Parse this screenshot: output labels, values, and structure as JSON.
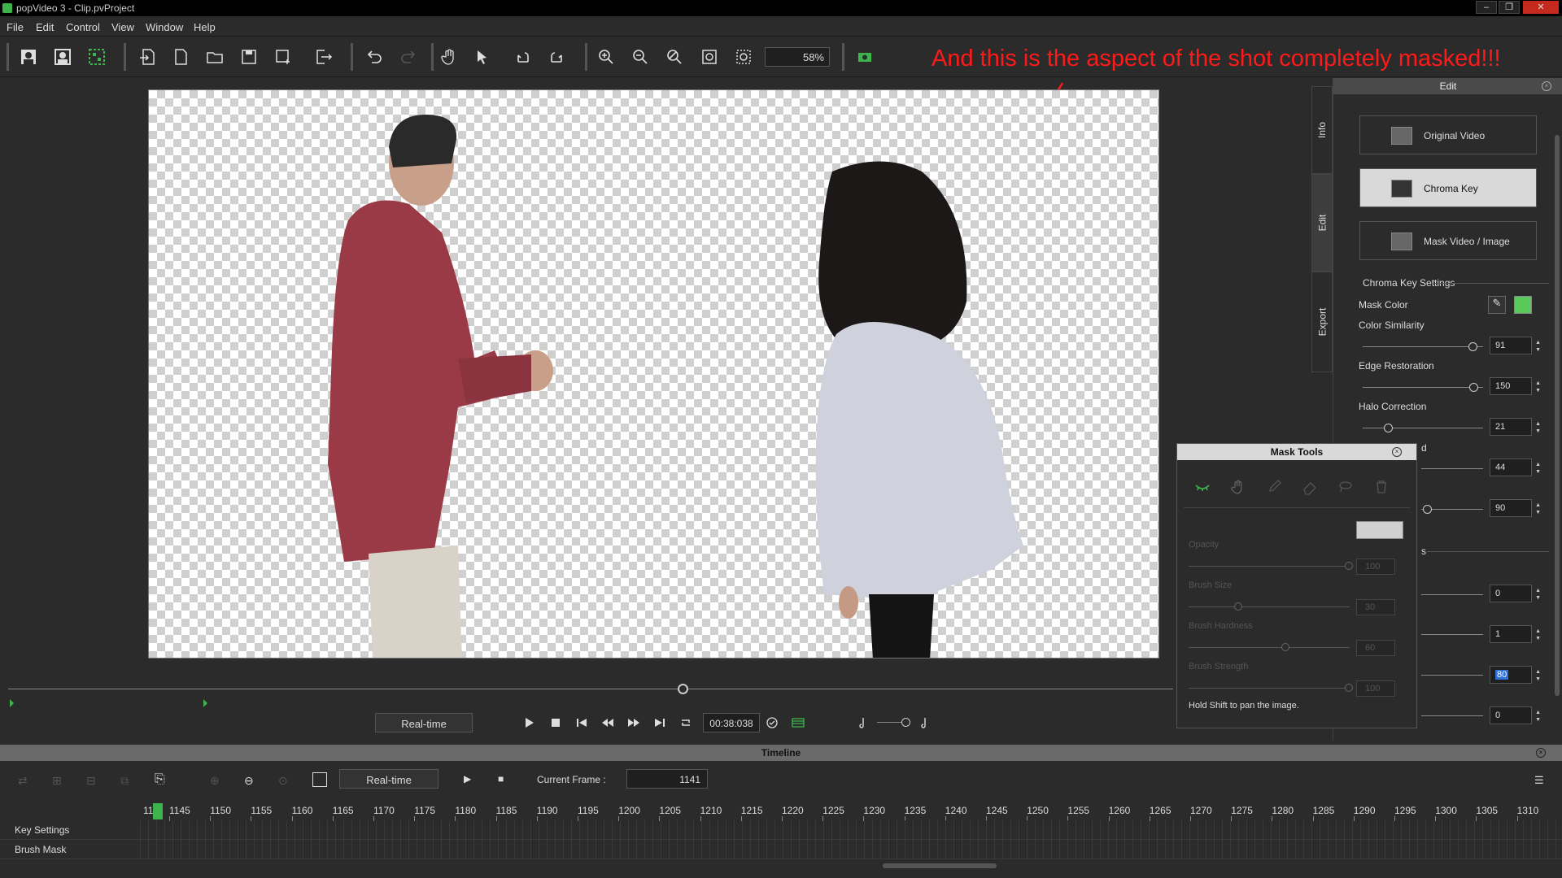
{
  "window": {
    "title": "popVideo 3 - Clip.pvProject",
    "minimize": "–",
    "restore": "❐",
    "close": "✕"
  },
  "menu": [
    "File",
    "Edit",
    "Control",
    "View",
    "Window",
    "Help"
  ],
  "toolbar": {
    "zoom": "58%"
  },
  "annotation": "And this is the aspect of the shot completely masked!!!",
  "transport": {
    "mode": "Real-time",
    "timecode": "00:38:038"
  },
  "side_tabs": [
    "Info",
    "Edit",
    "Export"
  ],
  "edit_panel": {
    "title": "Edit",
    "modes": [
      "Original Video",
      "Chroma Key",
      "Mask Video / Image"
    ],
    "section": "Chroma Key Settings",
    "mask_color_label": "Mask Color",
    "mask_color": "#5ac85a",
    "settings": [
      {
        "label": "Color Similarity",
        "value": "91",
        "fraction": 0.91
      },
      {
        "label": "Edge Restoration",
        "value": "150",
        "fraction": 0.92
      },
      {
        "label": "Halo Correction",
        "value": "21",
        "fraction": 0.21
      }
    ],
    "hidden_values": [
      "44",
      "90",
      "0",
      "1",
      "80",
      "0"
    ],
    "partial_label": "d",
    "partial_label_2": "s"
  },
  "mask_tools": {
    "title": "Mask Tools",
    "params": [
      {
        "label": "Opacity",
        "value": "100"
      },
      {
        "label": "Brush Size",
        "value": "30"
      },
      {
        "label": "Brush Hardness",
        "value": "60"
      },
      {
        "label": "Brush Strength",
        "value": "100"
      }
    ],
    "hint": "Hold Shift to pan the image."
  },
  "timeline": {
    "title": "Timeline",
    "mode": "Real-time",
    "current_frame_label": "Current Frame :",
    "current_frame": "1141",
    "first_tick": "11",
    "ticks": [
      "1145",
      "1150",
      "1155",
      "1160",
      "1165",
      "1170",
      "1175",
      "1180",
      "1185",
      "1190",
      "1195",
      "1200",
      "1205",
      "1210",
      "1215",
      "1220",
      "1225",
      "1230",
      "1235",
      "1240",
      "1245",
      "1250",
      "1255",
      "1260",
      "1265",
      "1270",
      "1275",
      "1280",
      "1285",
      "1290",
      "1295",
      "1300",
      "1305",
      "1310"
    ],
    "tracks": [
      "Key Settings",
      "Brush Mask"
    ]
  },
  "colors": {
    "accent_green": "#3cb44b",
    "annotation_red": "#ff1a1a"
  }
}
